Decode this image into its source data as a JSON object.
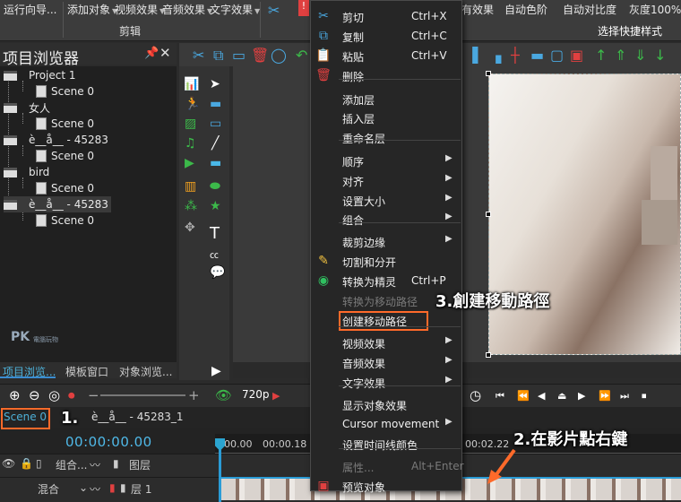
{
  "ribbon": {
    "items": [
      "运行向导...",
      "添加对象",
      "视频效果",
      "音频效果",
      "文字效果"
    ],
    "group_label": "剪辑",
    "right_items": [
      "有效果",
      "自动色阶",
      "自动对比度",
      "灰度100%"
    ],
    "shortcut_label": "选择快捷样式"
  },
  "project_browser": {
    "title": "项目浏览器",
    "pin": "ᴘ",
    "close": "✕",
    "tree": [
      {
        "label": "Project 1",
        "level": 0,
        "type": "project"
      },
      {
        "label": "Scene 0",
        "level": 1,
        "type": "scene"
      },
      {
        "label": "女人",
        "level": 0,
        "type": "project"
      },
      {
        "label": "Scene 0",
        "level": 1,
        "type": "scene"
      },
      {
        "label": "è__å__ - 45283",
        "level": 0,
        "type": "project"
      },
      {
        "label": "Scene 0",
        "level": 1,
        "type": "scene"
      },
      {
        "label": "bird",
        "level": 0,
        "type": "project"
      },
      {
        "label": "Scene 0",
        "level": 1,
        "type": "scene"
      },
      {
        "label": "è__å__ - 45283",
        "level": 0,
        "type": "project"
      },
      {
        "label": "Scene 0",
        "level": 1,
        "type": "scene"
      }
    ],
    "logo_main": "PK",
    "logo_sub": "電腦玩物",
    "tabs": [
      "项目浏览...",
      "模板窗口",
      "对象浏览..."
    ]
  },
  "timeline": {
    "resolution": "720p",
    "scene_tab": "Scene 0",
    "scene_path": "è__å__ - 45283_1",
    "timecode": "00:00:00.00",
    "ruler_labels": [
      "00.00",
      "00:00.18",
      "00:02.22"
    ],
    "track1_label": "组合...",
    "track1_layer": "图层",
    "track2_blend": "混合",
    "track2_layer": "层 1"
  },
  "context_menu": {
    "items": [
      {
        "label": "剪切",
        "shortcut": "Ctrl+X",
        "icon": "scissors-icon",
        "glyph": "✂",
        "color": "#4aa8e0"
      },
      {
        "label": "复制",
        "shortcut": "Ctrl+C",
        "icon": "copy-icon",
        "glyph": "⧉",
        "color": "#4aa8e0"
      },
      {
        "label": "粘贴",
        "shortcut": "Ctrl+V",
        "icon": "paste-icon",
        "glyph": "📋",
        "color": "#4aa8e0"
      },
      {
        "label": "删除",
        "icon": "trash-icon",
        "glyph": "🗑",
        "color": "#e04040"
      },
      {
        "sep": true
      },
      {
        "label": "添加层"
      },
      {
        "label": "插入层"
      },
      {
        "label": "重命名层"
      },
      {
        "sep": true
      },
      {
        "label": "顺序",
        "submenu": true
      },
      {
        "label": "对齐",
        "submenu": true
      },
      {
        "label": "设置大小",
        "submenu": true
      },
      {
        "label": "组合",
        "submenu": true
      },
      {
        "sep": true
      },
      {
        "label": "裁剪边缘",
        "submenu": true
      },
      {
        "label": "切割和分开",
        "icon": "wand-icon",
        "glyph": "✎",
        "color": "#f0c040"
      },
      {
        "label": "转换为精灵",
        "shortcut": "Ctrl+P",
        "icon": "sprite-icon",
        "glyph": "◉",
        "color": "#30c060"
      },
      {
        "label": "转换为移动路径",
        "disabled": true
      },
      {
        "label": "创建移动路径",
        "highlight": true
      },
      {
        "sep": true
      },
      {
        "label": "视频效果",
        "submenu": true
      },
      {
        "label": "音频效果",
        "submenu": true
      },
      {
        "label": "文字效果",
        "submenu": true
      },
      {
        "sep": true
      },
      {
        "label": "显示对象效果"
      },
      {
        "label": "Cursor movement",
        "submenu": true
      },
      {
        "label": "设置时间线颜色"
      },
      {
        "sep": true
      },
      {
        "label": "属性...",
        "shortcut": "Alt+Enter",
        "disabled": true
      },
      {
        "label": "预览对象",
        "icon": "preview-icon",
        "glyph": "▣",
        "color": "#e04040"
      }
    ]
  },
  "annotations": {
    "step1": "1.",
    "step2": "2.在影片點右鍵",
    "step3": "3.創建移動路徑"
  },
  "colors": {
    "accent_blue": "#2a9cd6",
    "annotation_orange": "#ff6a2a",
    "timecode": "#4fb9e8"
  }
}
